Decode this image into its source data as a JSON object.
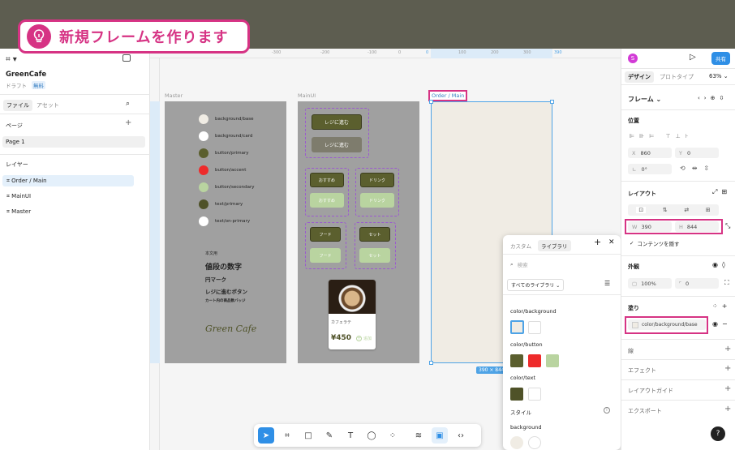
{
  "banner": {
    "text": "新規フレームを作ります",
    "icon": "lightbulb-icon"
  },
  "left": {
    "project": "GreenCafe",
    "draft": "ドラフト",
    "plan": "無料",
    "tabs": [
      "ファイル",
      "アセット"
    ],
    "pages_label": "ページ",
    "page1": "Page 1",
    "layers_label": "レイヤー",
    "layers": [
      "Order / Main",
      "MainUI",
      "Master"
    ]
  },
  "ruler": {
    "top": [
      "-500",
      "-400",
      "-300",
      "-200",
      "-100",
      "0",
      "100",
      "200",
      "300",
      "390"
    ],
    "left": [
      "0",
      "100",
      "200",
      "300",
      "400",
      "500",
      "600",
      "700",
      "844",
      "900",
      "1000"
    ]
  },
  "canvas": {
    "frame_master": "Master",
    "frame_mainui": "MainUI",
    "frame_order": "Order / Main",
    "size_badge": "390 × 844",
    "swatches": [
      {
        "label": "background/base",
        "color": "#f0ece4"
      },
      {
        "label": "background/card",
        "color": "#ffffff"
      },
      {
        "label": "button/primary",
        "color": "#5b5f2e"
      },
      {
        "label": "button/accent",
        "color": "#ee2b2b"
      },
      {
        "label": "button/secondary",
        "color": "#b9d4a0"
      },
      {
        "label": "text/primary",
        "color": "#4f5228"
      },
      {
        "label": "text/on-primary",
        "color": "#ffffff"
      }
    ],
    "type_samples": [
      "本文用",
      "値段の数字",
      "円マーク",
      "レジに進むボタン",
      "カート内の商品数バッジ"
    ],
    "logo": "Green Cafe",
    "mainui_buttons": {
      "reg": "レジに進む",
      "osusume": "おすすめ",
      "drink": "ドリンク",
      "food": "フード",
      "set": "セット"
    },
    "card": {
      "name": "カフェラテ",
      "price": "¥450",
      "add": "追加"
    }
  },
  "library": {
    "tabs": [
      "カスタム",
      "ライブラリ"
    ],
    "search_placeholder": "検索",
    "filter": "すべてのライブラリ",
    "groups": [
      {
        "name": "color/background",
        "colors": [
          "#f0ece4",
          "#ffffff"
        ]
      },
      {
        "name": "color/button",
        "colors": [
          "#5b5f2e",
          "#ee2b2b",
          "#b9d4a0"
        ]
      },
      {
        "name": "color/text",
        "colors": [
          "#4f5228",
          "#ffffff"
        ]
      }
    ],
    "style_label": "スタイル",
    "bg_label": "background"
  },
  "right": {
    "avatar": "S",
    "share": "共有",
    "tabs": [
      "デザイン",
      "プロトタイプ"
    ],
    "zoom": "63%",
    "frame_label": "フレーム",
    "position_label": "位置",
    "x": "860",
    "y": "0",
    "rotation": "0°",
    "layout_label": "レイアウト",
    "w": "390",
    "h": "844",
    "clip": "コンテンツを隠す",
    "appearance_label": "外観",
    "opacity": "100%",
    "radius": "0",
    "fill_label": "塗り",
    "fill_value": "color/background/base",
    "sections": [
      "線",
      "エフェクト",
      "レイアウトガイド",
      "エクスポート"
    ],
    "help": "?"
  },
  "colors": {
    "accent": "#d63384",
    "select": "#4ea3e6",
    "primary_btn": "#5b5f2e"
  }
}
